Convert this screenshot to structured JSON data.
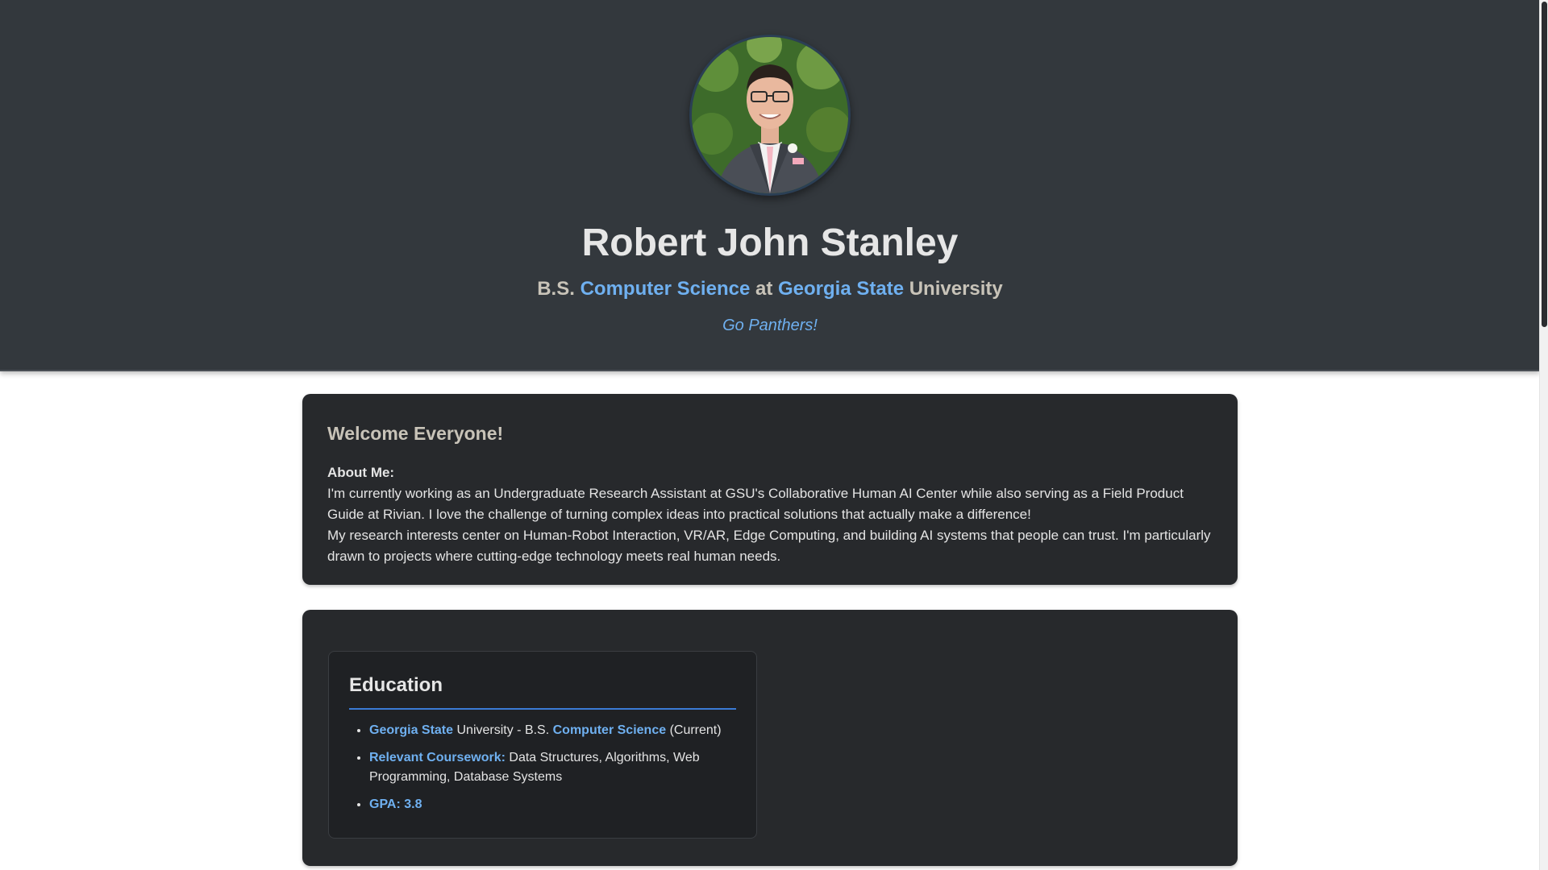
{
  "hero": {
    "name": "Robert John Stanley",
    "subtitle": {
      "prefix": "B.S.",
      "major": "Computer Science",
      "at": "at",
      "school": "Georgia State",
      "suffix": "University"
    },
    "tagline": "Go Panthers!"
  },
  "welcome": {
    "heading": "Welcome Everyone!",
    "about_label": "About Me:",
    "paragraph1": "I'm currently working as an Undergraduate Research Assistant at GSU's Collaborative Human AI Center while also serving as a Field Product Guide at Rivian. I love the challenge of turning complex ideas into practical solutions that actually make a difference!",
    "paragraph2": "My research interests center on Human-Robot Interaction, VR/AR, Edge Computing, and building AI systems that people can trust. I'm particularly drawn to projects where cutting-edge technology meets real human needs."
  },
  "education": {
    "heading": "Education",
    "items": [
      {
        "school": "Georgia State",
        "mid": "University - B.S.",
        "major": "Computer Science",
        "status": "(Current)"
      },
      {
        "label": "Relevant Coursework:",
        "text": "Data Structures, Algorithms, Web Programming, Database Systems"
      },
      {
        "label": "GPA: 3.8"
      }
    ]
  },
  "colors": {
    "hero_bg": "#33383d",
    "accent": "#6fb0f0",
    "card_bg": "#27292c",
    "underline": "#3a7bd5"
  }
}
